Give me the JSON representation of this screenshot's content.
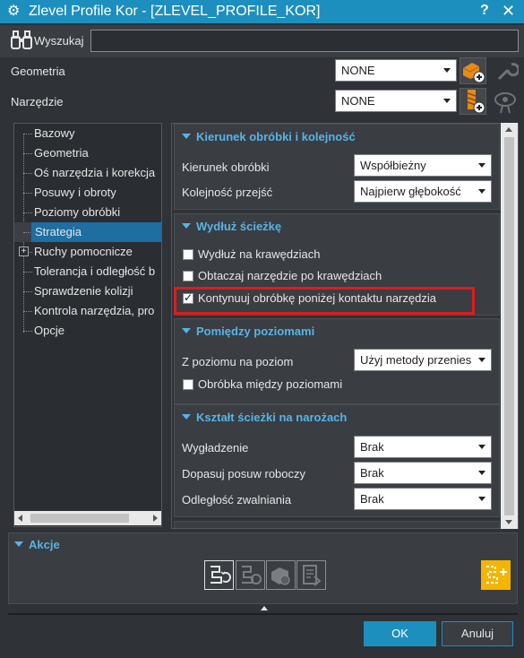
{
  "window": {
    "title": "Zlevel Profile Kor - [ZLEVEL_PROFILE_KOR]",
    "help": "?",
    "close": "✕"
  },
  "search": {
    "label": "Wyszukaj",
    "value": ""
  },
  "geometry": {
    "label": "Geometria",
    "value": "NONE"
  },
  "tool": {
    "label": "Narzędzie",
    "value": "NONE"
  },
  "tree": {
    "items": [
      {
        "label": "Bazowy"
      },
      {
        "label": "Geometria"
      },
      {
        "label": "Oś narzędzia i korekcja"
      },
      {
        "label": "Posuwy i obroty"
      },
      {
        "label": "Poziomy obróbki"
      },
      {
        "label": "Strategia",
        "selected": true
      },
      {
        "label": "Ruchy pomocnicze",
        "expandable": true,
        "expander": "+"
      },
      {
        "label": "Tolerancja i odległość b"
      },
      {
        "label": "Sprawdzenie kolizji"
      },
      {
        "label": "Kontrola narzędzia, pro"
      },
      {
        "label": "Opcje"
      }
    ]
  },
  "groups": {
    "cut_direction": {
      "title": "Kierunek obróbki i kolejność",
      "rows": [
        {
          "label": "Kierunek obróbki",
          "value": "Współbieżny"
        },
        {
          "label": "Kolejność przejść",
          "value": "Najpierw głębokość"
        }
      ]
    },
    "extend_path": {
      "title": "Wydłuż ścieżkę",
      "options": [
        {
          "label": "Wydłuż na krawędziach",
          "checked": false
        },
        {
          "label": "Obtaczaj narzędzie po krawędziach",
          "checked": false
        },
        {
          "label": "Kontynuuj obróbkę poniżej kontaktu narzędzia",
          "checked": true
        }
      ]
    },
    "between_levels": {
      "title": "Pomiędzy poziomami",
      "row": {
        "label": "Z poziomu na poziom",
        "value": "Użyj metody przenies"
      },
      "option": {
        "label": "Obróbka między poziomami",
        "checked": false
      }
    },
    "corner_shape": {
      "title": "Kształt ścieżki na narożach",
      "rows": [
        {
          "label": "Wygładzenie",
          "value": "Brak"
        },
        {
          "label": "Dopasuj posuw roboczy",
          "value": "Brak"
        },
        {
          "label": "Odległość zwalniania",
          "value": "Brak"
        }
      ]
    }
  },
  "actions": {
    "title": "Akcje"
  },
  "buttons": {
    "ok": "OK",
    "cancel": "Anuluj"
  },
  "colors": {
    "accent": "#1d8fbf",
    "highlight_box": "#e01b1b",
    "section_header": "#56b4e6",
    "action_active": "#f5b400"
  }
}
